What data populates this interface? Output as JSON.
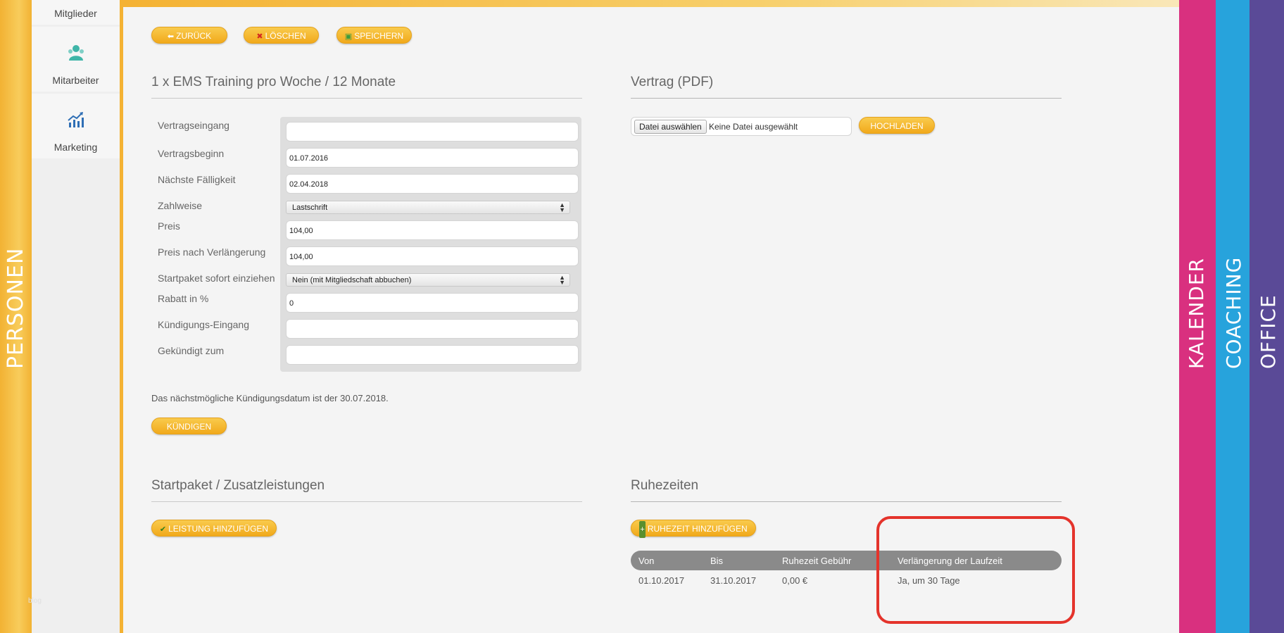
{
  "left_tab": {
    "label": "PERSONEN"
  },
  "sidebar": {
    "items": [
      {
        "label": "Mitglieder",
        "icon": "members-icon"
      },
      {
        "label": "Mitarbeiter",
        "icon": "staff-icon"
      },
      {
        "label": "Marketing",
        "icon": "chart-trend-icon"
      }
    ],
    "footer": "blog"
  },
  "toolbar": {
    "back_label": "ZURÜCK",
    "delete_label": "LÖSCHEN",
    "save_label": "SPEICHERN"
  },
  "contract": {
    "title": "1 x EMS Training pro Woche / 12 Monate",
    "fields": [
      {
        "label": "Vertragseingang",
        "value": ""
      },
      {
        "label": "Vertragsbeginn",
        "value": "01.07.2016"
      },
      {
        "label": "Nächste Fälligkeit",
        "value": "02.04.2018"
      },
      {
        "label": "Zahlweise",
        "value": "Lastschrift"
      },
      {
        "label": "Preis",
        "value": "104,00"
      },
      {
        "label": "Preis nach Verlängerung",
        "value": "104,00"
      },
      {
        "label": "Startpaket sofort einziehen",
        "value": "Nein (mit Mitgliedschaft abbuchen)"
      },
      {
        "label": "Rabatt in %",
        "value": "0"
      },
      {
        "label": "Kündigungs-Eingang",
        "value": ""
      },
      {
        "label": "Gekündigt zum",
        "value": ""
      }
    ],
    "notice": "Das nächstmögliche Kündigungsdatum ist der 30.07.2018.",
    "cancel_label": "KÜNDIGEN"
  },
  "pdf": {
    "title": "Vertrag (PDF)",
    "choose_label": "Datei auswählen",
    "no_file": "Keine Datei ausgewählt",
    "upload_label": "HOCHLADEN"
  },
  "startpaket": {
    "title": "Startpaket / Zusatzleistungen",
    "add_label": "LEISTUNG HINZUFÜGEN"
  },
  "ruhezeiten": {
    "title": "Ruhezeiten",
    "add_label": "RUHEZEIT HINZUFÜGEN",
    "columns": [
      "Von",
      "Bis",
      "Ruhezeit Gebühr",
      "Verlängerung der Laufzeit"
    ],
    "rows": [
      [
        "01.10.2017",
        "31.10.2017",
        "0,00 €",
        "Ja, um 30 Tage"
      ]
    ]
  },
  "right_tabs": [
    {
      "label": "KALENDER",
      "color": "#d9307f"
    },
    {
      "label": "COACHING",
      "color": "#27a3dc"
    },
    {
      "label": "OFFICE",
      "color": "#5a4a97"
    }
  ],
  "colors": {
    "accent": "#f4b233",
    "highlight": "#e4332b"
  }
}
